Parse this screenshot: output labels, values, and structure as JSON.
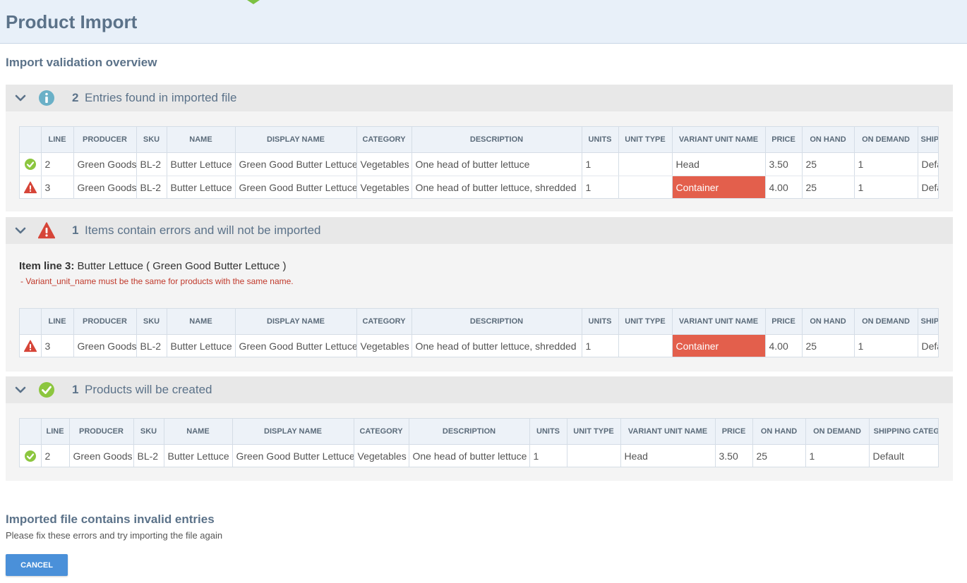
{
  "page": {
    "title": "Product Import",
    "subtitle": "Import validation overview"
  },
  "colors": {
    "brand_tip": "#7cc142",
    "error_cell": "#e35f4c",
    "ok_icon": "#8cc63f",
    "error_icon": "#d64538",
    "info_icon": "#6ab0c7",
    "primary_button": "#4a90d9"
  },
  "icons": {
    "collapse": "chevron-down-icon",
    "info": "info-icon",
    "warning": "warning-icon",
    "success": "check-circle-icon"
  },
  "sections": {
    "entries": {
      "count": "2",
      "label": "Entries found in imported file"
    },
    "errors": {
      "count": "1",
      "label": "Items contain errors and will not be imported",
      "item_prefix": "Item line 3:",
      "item_text": "Butter Lettuce ( Green Good Butter Lettuce )",
      "message": "-  Variant_unit_name must be the same for products with the same name."
    },
    "created": {
      "count": "1",
      "label": "Products will be created"
    }
  },
  "columns": [
    "LINE",
    "PRODUCER",
    "SKU",
    "NAME",
    "DISPLAY NAME",
    "CATEGORY",
    "DESCRIPTION",
    "UNITS",
    "UNIT TYPE",
    "VARIANT UNIT NAME",
    "PRICE",
    "ON HAND",
    "ON DEMAND",
    "SHIPPING CATEGORY"
  ],
  "tables": {
    "entries": [
      {
        "status": "ok",
        "line": "2",
        "producer": "Green Goods",
        "sku": "BL-2",
        "name": "Butter Lettuce",
        "display_name": "Green Good Butter Lettuce",
        "category": "Vegetables",
        "description": "One head of butter lettuce",
        "units": "1",
        "unit_type": "",
        "variant_unit_name": "Head",
        "price": "3.50",
        "on_hand": "25",
        "on_demand": "1",
        "shipping": "Default"
      },
      {
        "status": "error",
        "line": "3",
        "producer": "Green Goods",
        "sku": "BL-2",
        "name": "Butter Lettuce",
        "display_name": "Green Good Butter Lettuce",
        "category": "Vegetables",
        "description": "One head of butter lettuce, shredded",
        "units": "1",
        "unit_type": "",
        "variant_unit_name": "Container",
        "price": "4.00",
        "on_hand": "25",
        "on_demand": "1",
        "shipping": "Default"
      }
    ],
    "errors": [
      {
        "status": "error",
        "line": "3",
        "producer": "Green Goods",
        "sku": "BL-2",
        "name": "Butter Lettuce",
        "display_name": "Green Good Butter Lettuce",
        "category": "Vegetables",
        "description": "One head of butter lettuce, shredded",
        "units": "1",
        "unit_type": "",
        "variant_unit_name": "Container",
        "price": "4.00",
        "on_hand": "25",
        "on_demand": "1",
        "shipping": "Default"
      }
    ],
    "created": [
      {
        "status": "ok",
        "line": "2",
        "producer": "Green Goods",
        "sku": "BL-2",
        "name": "Butter Lettuce",
        "display_name": "Green Good Butter Lettuce",
        "category": "Vegetables",
        "description": "One head of butter lettuce",
        "units": "1",
        "unit_type": "",
        "variant_unit_name": "Head",
        "price": "3.50",
        "on_hand": "25",
        "on_demand": "1",
        "shipping": "Default"
      }
    ]
  },
  "footer": {
    "title": "Imported file contains invalid entries",
    "text": "Please fix these errors and try importing the file again",
    "cancel_label": "CANCEL"
  }
}
